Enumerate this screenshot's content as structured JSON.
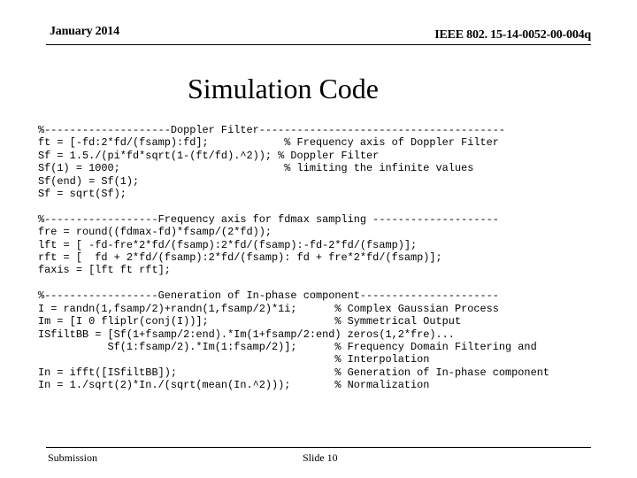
{
  "header": {
    "date": "January 2014",
    "doc_id": "IEEE 802. 15-14-0052-00-004q"
  },
  "title": "Simulation Code",
  "code_lines": [
    "%--------------------Doppler Filter---------------------------------------",
    "ft = [-fd:2*fd/(fsamp):fd];            % Frequency axis of Doppler Filter",
    "Sf = 1.5./(pi*fd*sqrt(1-(ft/fd).^2)); % Doppler Filter",
    "Sf(1) = 1000;                          % limiting the infinite values",
    "Sf(end) = Sf(1);",
    "Sf = sqrt(Sf);",
    "",
    "%------------------Frequency axis for fdmax sampling --------------------",
    "fre = round((fdmax-fd)*fsamp/(2*fd));",
    "lft = [ -fd-fre*2*fd/(fsamp):2*fd/(fsamp):-fd-2*fd/(fsamp)];",
    "rft = [  fd + 2*fd/(fsamp):2*fd/(fsamp): fd + fre*2*fd/(fsamp)];",
    "faxis = [lft ft rft];",
    "",
    "%------------------Generation of In-phase component----------------------",
    "I = randn(1,fsamp/2)+randn(1,fsamp/2)*1i;      % Complex Gaussian Process",
    "Im = [I 0 fliplr(conj(I))];                    % Symmetrical Output",
    "ISfiltBB = [Sf(1+fsamp/2:end).*Im(1+fsamp/2:end) zeros(1,2*fre)...",
    "           Sf(1:fsamp/2).*Im(1:fsamp/2)];      % Frequency Domain Filtering and",
    "                                               % Interpolation",
    "In = ifft([ISfiltBB]);                         % Generation of In-phase component",
    "In = 1./sqrt(2)*In./(sqrt(mean(In.^2)));       % Normalization"
  ],
  "footer": {
    "left": "Submission",
    "center": "Slide 10"
  }
}
